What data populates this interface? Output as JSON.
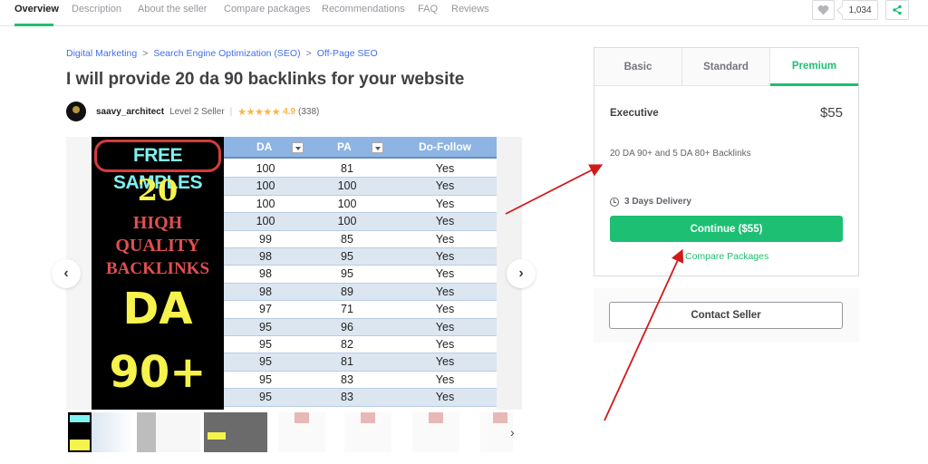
{
  "top_nav": {
    "tabs": [
      {
        "label": "Overview",
        "active": true
      },
      {
        "label": "Description"
      },
      {
        "label": "About the seller"
      },
      {
        "label": "Compare packages"
      },
      {
        "label": "Recommendations"
      },
      {
        "label": "FAQ"
      },
      {
        "label": "Reviews"
      }
    ],
    "like_count": "1,034",
    "icons": {
      "like": "heart-icon",
      "share": "share-icon"
    },
    "accent_color": "#1dbf73"
  },
  "breadcrumb": [
    "Digital Marketing",
    "Search Engine Optimization (SEO)",
    "Off-Page SEO"
  ],
  "breadcrumb_separator": ">",
  "gig": {
    "title": "I will provide 20 da 90 backlinks for your website",
    "seller": {
      "name": "saavy_architect",
      "level": "Level 2 Seller",
      "separator": "|",
      "stars": "★★★★★",
      "rating": "4.9",
      "reviews": "(338)"
    }
  },
  "gallery": {
    "promo": {
      "badge": "FREE SAMPLES",
      "count": "20",
      "line1": "HIQH",
      "line2": "QUALITY",
      "line3": "BACKLINKS",
      "big1": "DA",
      "big2": "90+"
    },
    "sheet": {
      "headers": [
        "DA",
        "PA",
        "Do-Follow"
      ],
      "rows": [
        [
          "100",
          "81",
          "Yes"
        ],
        [
          "100",
          "100",
          "Yes"
        ],
        [
          "100",
          "100",
          "Yes"
        ],
        [
          "100",
          "100",
          "Yes"
        ],
        [
          "99",
          "85",
          "Yes"
        ],
        [
          "98",
          "95",
          "Yes"
        ],
        [
          "98",
          "95",
          "Yes"
        ],
        [
          "98",
          "89",
          "Yes"
        ],
        [
          "97",
          "71",
          "Yes"
        ],
        [
          "95",
          "96",
          "Yes"
        ],
        [
          "95",
          "82",
          "Yes"
        ],
        [
          "95",
          "81",
          "Yes"
        ],
        [
          "95",
          "83",
          "Yes"
        ],
        [
          "95",
          "83",
          "Yes"
        ]
      ]
    },
    "prev_icon": "‹",
    "next_icon": "›",
    "thumb_next_icon": "›",
    "thumbnail_count": 7
  },
  "package": {
    "tabs": [
      {
        "label": "Basic"
      },
      {
        "label": "Standard"
      },
      {
        "label": "Premium",
        "active": true
      }
    ],
    "name": "Executive",
    "price": "$55",
    "description": "20 DA 90+ and 5 DA 80+ Backlinks",
    "delivery": "3 Days Delivery",
    "continue_label": "Continue ($55)",
    "compare_label": "Compare Packages",
    "contact_label": "Contact Seller"
  }
}
